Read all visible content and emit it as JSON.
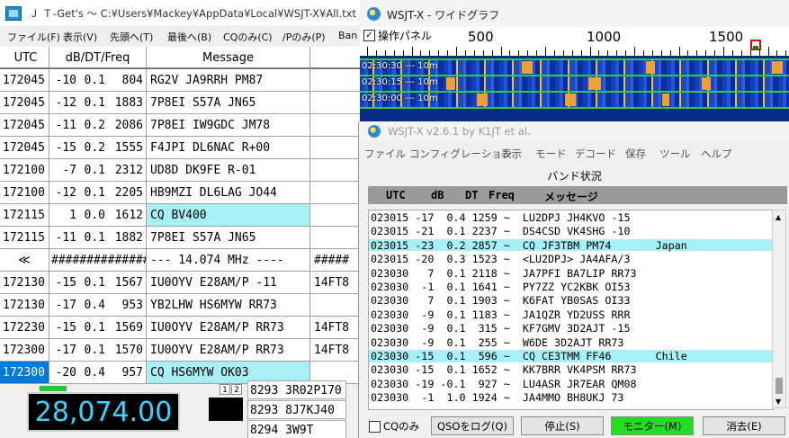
{
  "jtget": {
    "title": "Ｊ Ｔ-Get's 〜 C:¥Users¥Mackey¥AppData¥Local¥WSJT-X¥All.txt",
    "menu": [
      "ファイル(F)",
      "表示(V)",
      "先頭へ(T)",
      "最後へ(B)",
      "CQのみ(C)",
      "/Pのみ(P)",
      "Ban"
    ],
    "columns": {
      "utc": "UTC",
      "dbdtfreq": "dB/DT/Freq",
      "message": "Message"
    },
    "rows": [
      {
        "utc": "172045",
        "db": "-10",
        "dt": "0.1",
        "freq": "804",
        "msg": "RG2V JA9RRH PM87",
        "extra": "",
        "cq": false
      },
      {
        "utc": "172045",
        "db": "-12",
        "dt": "0.1",
        "freq": "1883",
        "msg": "7P8EI S57A JN65",
        "extra": "",
        "cq": false
      },
      {
        "utc": "172045",
        "db": "-11",
        "dt": "0.2",
        "freq": "2086",
        "msg": "7P8EI IW9GDC JM78",
        "extra": "",
        "cq": false
      },
      {
        "utc": "172045",
        "db": "-15",
        "dt": "0.2",
        "freq": "1555",
        "msg": "F4JPI DL6NAC R+00",
        "extra": "",
        "cq": false
      },
      {
        "utc": "172100",
        "db": "-7",
        "dt": "0.1",
        "freq": "2312",
        "msg": "UD8D DK9FE R-01",
        "extra": "",
        "cq": false
      },
      {
        "utc": "172100",
        "db": "-12",
        "dt": "0.1",
        "freq": "2205",
        "msg": "HB9MZI DL6LAG JO44",
        "extra": "",
        "cq": false
      },
      {
        "utc": "172115",
        "db": "1",
        "dt": "0.0",
        "freq": "1612",
        "msg": "CQ BV400",
        "extra": "",
        "cq": true
      },
      {
        "utc": "172115",
        "db": "-11",
        "dt": "0.1",
        "freq": "1882",
        "msg": "7P8EI S57A JN65",
        "extra": "",
        "cq": false
      },
      {
        "utc": "≪",
        "db": "",
        "dt": "",
        "freq": "##############",
        "msg": "--- 14.074 MHz ----",
        "extra": "#####",
        "cq": false,
        "sep": true
      },
      {
        "utc": "172130",
        "db": "-15",
        "dt": "0.1",
        "freq": "1567",
        "msg": "IU0OYV E28AM/P -11",
        "extra": "14FT8",
        "cq": false
      },
      {
        "utc": "172130",
        "db": "-17",
        "dt": "0.4",
        "freq": "953",
        "msg": "YB2LHW HS6MYW RR73",
        "extra": "",
        "cq": false
      },
      {
        "utc": "172230",
        "db": "-15",
        "dt": "0.1",
        "freq": "1569",
        "msg": "IU0OYV E28AM/P RR73",
        "extra": "14FT8",
        "cq": false
      },
      {
        "utc": "172300",
        "db": "-17",
        "dt": "0.1",
        "freq": "1570",
        "msg": "IU0OYV E28AM/P RR73",
        "extra": "14FT8",
        "cq": false
      },
      {
        "utc": "172300",
        "db": "-20",
        "dt": "0.4",
        "freq": "957",
        "msg": "CQ HS6MYW OK03",
        "extra": "",
        "cq": true,
        "selected": true
      }
    ],
    "frequency": "28,074.00",
    "mini_rows": [
      "8293 3R02P170",
      "8293 8J7KJ40",
      "8294 3W9T"
    ],
    "tabs": [
      "1",
      "2"
    ]
  },
  "widegraph": {
    "title": "WSJT-X - ワイドグラフ",
    "control_panel_label": "操作パネル",
    "scale_ticks": [
      "500",
      "1000",
      "1500"
    ],
    "band_labels": [
      "02:30:30 --- 10m",
      "02:30:15 --- 10m",
      "02:30:00 --- 10m"
    ]
  },
  "wsjtx": {
    "title": "WSJT-X   v2.6.1   by K1JT et al.",
    "menu": [
      "ファイル",
      "コンフィグレーション",
      "表示",
      "モード",
      "デコード",
      "保存",
      "ツール",
      "ヘルプ"
    ],
    "band_activity_title": "バンド状況",
    "list_header": {
      "utc": "UTC",
      "db": "dB",
      "dt": "DT",
      "freq": "Freq",
      "message": "メッセージ"
    },
    "decodes": [
      {
        "text": "023015 -17  0.4 1259 ~  LU2DPJ JH4KVO -15",
        "cq": false
      },
      {
        "text": "023015 -21  0.1 2237 ~  DS4CSD VK4SHG -10",
        "cq": false
      },
      {
        "text": "023015 -23  0.2 2857 ~  CQ JF3TBM PM74       Japan",
        "cq": true
      },
      {
        "text": "023015 -20  0.3 1523 ~  <LU2DPJ> JA4AFA/3",
        "cq": false
      },
      {
        "text": "023030   7  0.1 2118 ~  JA7PFI BA7LIP RR73",
        "cq": false
      },
      {
        "text": "023030  -1  0.1 1641 ~  PY7ZZ YC2KBK OI53",
        "cq": false
      },
      {
        "text": "023030   7  0.1 1903 ~  K6FAT YB0SAS OI33",
        "cq": false
      },
      {
        "text": "023030  -9  0.1 1183 ~  JA1QZR YD2USS RRR",
        "cq": false
      },
      {
        "text": "023030  -9  0.1  315 ~  KF7GMV 3D2AJT -15",
        "cq": false
      },
      {
        "text": "023030  -9  0.1  255 ~  W6DE 3D2AJT RR73",
        "cq": false
      },
      {
        "text": "023030 -15  0.1  596 ~  CQ CE3TMM FF46       Chile",
        "cq": true
      },
      {
        "text": "023030 -15  0.1 1652 ~  KK7BRR VK4PSM RR73",
        "cq": false
      },
      {
        "text": "023030 -19 -0.1  927 ~  LU4ASR JR7EAR QM08",
        "cq": false
      },
      {
        "text": "023030  -1  1.0 1924 ~  JA4MMO BH8UKJ 73",
        "cq": false
      }
    ],
    "cq_only_label": "CQのみ",
    "buttons": {
      "log_qso": "QSOをログ(Q)",
      "stop": "停止(S)",
      "monitor": "モニター(M)",
      "erase": "消去(E)"
    }
  }
}
